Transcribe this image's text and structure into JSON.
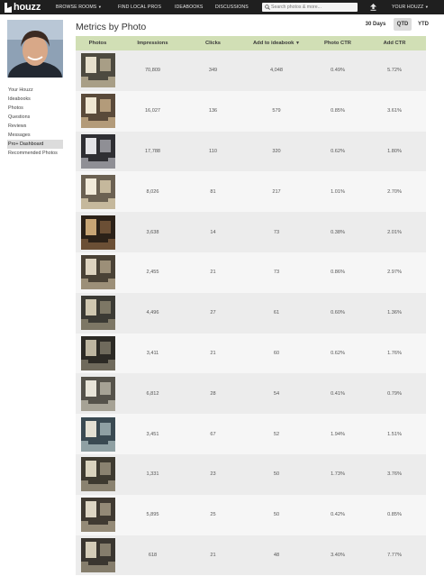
{
  "nav": {
    "logo": "houzz",
    "browse_rooms": "BROWSE ROOMS",
    "find_local_pros": "FIND LOCAL PROS",
    "ideabooks": "IDEABOOKS",
    "discussions": "DISCUSSIONS",
    "search_placeholder": "Search photos & more...",
    "your_houzz": "YOUR HOUZZ"
  },
  "sidebar": {
    "items": [
      {
        "label": "Your Houzz"
      },
      {
        "label": "Ideabooks"
      },
      {
        "label": "Photos"
      },
      {
        "label": "Questions"
      },
      {
        "label": "Reviews"
      },
      {
        "label": "Messages"
      },
      {
        "label": "Pro+ Dashboard"
      },
      {
        "label": "Recommended Photos"
      }
    ],
    "active_item": "Pro+ Dashboard"
  },
  "main": {
    "title": "Metrics by Photo",
    "periods": [
      "30 Days",
      "QTD",
      "YTD"
    ],
    "selected_period": "QTD"
  },
  "table": {
    "columns": [
      "Photos",
      "Impressions",
      "Clicks",
      "Add to ideabook",
      "Photo CTR",
      "Add CTR"
    ],
    "sort_indicator": "▼",
    "rows": [
      {
        "impressions": "70,809",
        "clicks": "349",
        "add_to_ideabook": "4,048",
        "photo_ctr": "0.49%",
        "add_ctr": "5.72%"
      },
      {
        "impressions": "16,027",
        "clicks": "136",
        "add_to_ideabook": "579",
        "photo_ctr": "0.85%",
        "add_ctr": "3.61%"
      },
      {
        "impressions": "17,788",
        "clicks": "110",
        "add_to_ideabook": "320",
        "photo_ctr": "0.62%",
        "add_ctr": "1.80%"
      },
      {
        "impressions": "8,026",
        "clicks": "81",
        "add_to_ideabook": "217",
        "photo_ctr": "1.01%",
        "add_ctr": "2.70%"
      },
      {
        "impressions": "3,638",
        "clicks": "14",
        "add_to_ideabook": "73",
        "photo_ctr": "0.38%",
        "add_ctr": "2.01%"
      },
      {
        "impressions": "2,455",
        "clicks": "21",
        "add_to_ideabook": "73",
        "photo_ctr": "0.86%",
        "add_ctr": "2.97%"
      },
      {
        "impressions": "4,496",
        "clicks": "27",
        "add_to_ideabook": "61",
        "photo_ctr": "0.60%",
        "add_ctr": "1.36%"
      },
      {
        "impressions": "3,411",
        "clicks": "21",
        "add_to_ideabook": "60",
        "photo_ctr": "0.62%",
        "add_ctr": "1.76%"
      },
      {
        "impressions": "6,812",
        "clicks": "28",
        "add_to_ideabook": "54",
        "photo_ctr": "0.41%",
        "add_ctr": "0.79%"
      },
      {
        "impressions": "3,451",
        "clicks": "67",
        "add_to_ideabook": "52",
        "photo_ctr": "1.94%",
        "add_ctr": "1.51%"
      },
      {
        "impressions": "1,331",
        "clicks": "23",
        "add_to_ideabook": "50",
        "photo_ctr": "1.73%",
        "add_ctr": "3.76%"
      },
      {
        "impressions": "5,895",
        "clicks": "25",
        "add_to_ideabook": "50",
        "photo_ctr": "0.42%",
        "add_ctr": "0.85%"
      },
      {
        "impressions": "618",
        "clicks": "21",
        "add_to_ideabook": "48",
        "photo_ctr": "3.40%",
        "add_ctr": "7.77%"
      }
    ]
  },
  "colors": {
    "topbar": "#1f1f1f",
    "header_row": "#d1dfb5",
    "row_odd": "#ececec",
    "row_even": "#f6f6f6"
  },
  "icons": {
    "logo": "houzz-logo-icon",
    "dropdown": "chevron-down-icon",
    "search": "search-icon",
    "upload": "upload-icon"
  }
}
